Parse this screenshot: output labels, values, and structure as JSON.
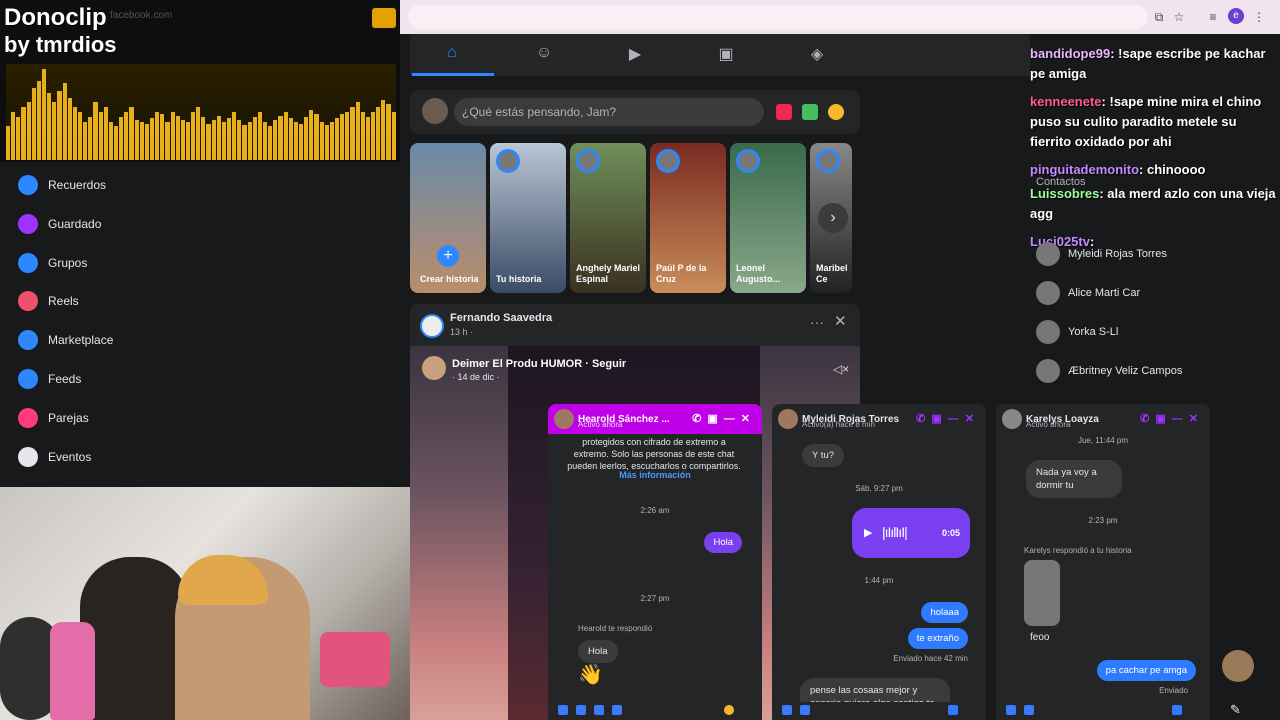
{
  "browser": {
    "icons": [
      "install-icon",
      "star-icon",
      "tab-search-icon",
      "profile-icon",
      "menu-icon"
    ],
    "profile_letter": "e"
  },
  "overlay": {
    "brand": "Donoclip",
    "by_label": "by",
    "streamer": "tmrdios",
    "faded_url": "facebook.com",
    "eq_levels": [
      0.35,
      0.5,
      0.45,
      0.55,
      0.6,
      0.75,
      0.82,
      0.95,
      0.7,
      0.6,
      0.72,
      0.8,
      0.65,
      0.55,
      0.5,
      0.4,
      0.45,
      0.6,
      0.5,
      0.55,
      0.4,
      0.35,
      0.45,
      0.5,
      0.55,
      0.42,
      0.4,
      0.38,
      0.44,
      0.5,
      0.48,
      0.4,
      0.5,
      0.46,
      0.42,
      0.4,
      0.5,
      0.55,
      0.45,
      0.38,
      0.42,
      0.46,
      0.4,
      0.44,
      0.5,
      0.42,
      0.36,
      0.4,
      0.45,
      0.5,
      0.4,
      0.35,
      0.42,
      0.46,
      0.5,
      0.44,
      0.4,
      0.38,
      0.45,
      0.52,
      0.48,
      0.4,
      0.36,
      0.4,
      0.44,
      0.48,
      0.5,
      0.55,
      0.6,
      0.5,
      0.45,
      0.5,
      0.55,
      0.62,
      0.58,
      0.5
    ]
  },
  "sidebar": {
    "items": [
      {
        "label": "Recuerdos",
        "icon": "clock-icon",
        "color": "#2d88ff"
      },
      {
        "label": "Guardado",
        "icon": "bookmark-icon",
        "color": "#a033ff"
      },
      {
        "label": "Grupos",
        "icon": "groups-icon",
        "color": "#2d88ff"
      },
      {
        "label": "Reels",
        "icon": "reels-icon",
        "color": "#f0506e"
      },
      {
        "label": "Marketplace",
        "icon": "shop-icon",
        "color": "#2d88ff"
      },
      {
        "label": "Feeds",
        "icon": "feeds-icon",
        "color": "#2d88ff"
      },
      {
        "label": "Parejas",
        "icon": "heart-icon",
        "color": "#ff3b7f"
      },
      {
        "label": "Eventos",
        "icon": "calendar-icon",
        "color": "#e4e6eb"
      }
    ]
  },
  "nav": {
    "tabs": [
      "home-icon",
      "friends-icon",
      "video-icon",
      "marketplace-icon",
      "gaming-icon"
    ]
  },
  "composer": {
    "placeholder": "¿Qué estás pensando, Jam?"
  },
  "stories": [
    {
      "label": "Crear historia"
    },
    {
      "label": "Tu historia"
    },
    {
      "label": "Anghely Mariel Espinal"
    },
    {
      "label": "Paúl P de la Cruz"
    },
    {
      "label": "Leonel Augusto..."
    },
    {
      "label": "Maribel Ce"
    }
  ],
  "post": {
    "author": "Fernando Saavedra",
    "time": "13 h · ",
    "reel_author": "Deimer El Produ HUMOR · Seguir",
    "reel_date": "· 14 de dic · "
  },
  "chat_feed": [
    {
      "user": "bandidope99",
      "text": ": !sape escribe pe kachar pe amiga",
      "color": "#e9b8ff"
    },
    {
      "user": "kenneenete",
      "text": ": !sape mine mira el chino puso su culito paradito metele su fierrito oxidado por ahi",
      "color": "#ff5c8a"
    },
    {
      "user": "pinguitademonito",
      "text": ": chinoooo",
      "color": "#c38bff"
    },
    {
      "user": "Luissobres",
      "text": ": ala merd azlo con una vieja agg",
      "color": "#9dff9d"
    },
    {
      "user": "Luci025tv",
      "text": ": ",
      "color": "#c38bff"
    }
  ],
  "contacts_header": "Contactos",
  "contacts": [
    {
      "name": "Myleidi Rojas Torres"
    },
    {
      "name": "Alice Marti Car"
    },
    {
      "name": "Yorka S-Ll"
    },
    {
      "name": "Æbritney Veliz Campos"
    }
  ],
  "chats": [
    {
      "name": "Hearold Sánchez ...",
      "status": "Activo ahora",
      "encrypted_note": "protegidos con cifrado de extremo a extremo. Solo las personas de este chat pueden leerlos, escucharlos o compartirlos.",
      "more_info": "Más información",
      "t1": "2:26 am",
      "out1": "Hola",
      "t2": "2:27 pm",
      "reply_note": "Hearold te respondió",
      "in1": "Hola",
      "emoji": "👋"
    },
    {
      "name": "Myleidi Rojas Torres",
      "status": "Activo(a) hace 8 min",
      "in1": "Y tu?",
      "t1": "Sáb, 9:27 pm",
      "voice_time": "0:05",
      "t2": "1:44 pm",
      "out1": "holaaa",
      "out2": "te extraño",
      "sent_note": "Enviado hace 42 min",
      "in2": "pense las cosaas mejor y enserio quiero algo contigo te extraño mucho"
    },
    {
      "name": "Karelys Loayza",
      "status": "Activo ahora",
      "t0": "Jue, 11:44 pm",
      "in1": "Nada ya voy a dormir tu",
      "t1": "2:23 pm",
      "reply_note": "Karelys respondió a tu historia",
      "in2": "feoo",
      "out1": "pa cachar pe amga",
      "sent_note": "Enviado"
    }
  ]
}
